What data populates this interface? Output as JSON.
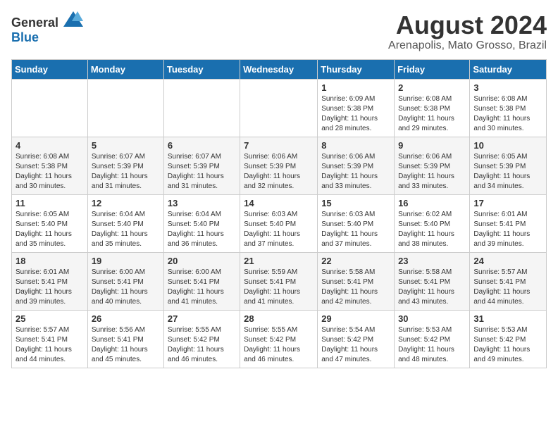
{
  "header": {
    "logo_general": "General",
    "logo_blue": "Blue",
    "title": "August 2024",
    "subtitle": "Arenapolis, Mato Grosso, Brazil"
  },
  "columns": [
    "Sunday",
    "Monday",
    "Tuesday",
    "Wednesday",
    "Thursday",
    "Friday",
    "Saturday"
  ],
  "rows": [
    [
      {
        "day": "",
        "info": ""
      },
      {
        "day": "",
        "info": ""
      },
      {
        "day": "",
        "info": ""
      },
      {
        "day": "",
        "info": ""
      },
      {
        "day": "1",
        "info": "Sunrise: 6:09 AM\nSunset: 5:38 PM\nDaylight: 11 hours and 28 minutes."
      },
      {
        "day": "2",
        "info": "Sunrise: 6:08 AM\nSunset: 5:38 PM\nDaylight: 11 hours and 29 minutes."
      },
      {
        "day": "3",
        "info": "Sunrise: 6:08 AM\nSunset: 5:38 PM\nDaylight: 11 hours and 30 minutes."
      }
    ],
    [
      {
        "day": "4",
        "info": "Sunrise: 6:08 AM\nSunset: 5:38 PM\nDaylight: 11 hours and 30 minutes."
      },
      {
        "day": "5",
        "info": "Sunrise: 6:07 AM\nSunset: 5:39 PM\nDaylight: 11 hours and 31 minutes."
      },
      {
        "day": "6",
        "info": "Sunrise: 6:07 AM\nSunset: 5:39 PM\nDaylight: 11 hours and 31 minutes."
      },
      {
        "day": "7",
        "info": "Sunrise: 6:06 AM\nSunset: 5:39 PM\nDaylight: 11 hours and 32 minutes."
      },
      {
        "day": "8",
        "info": "Sunrise: 6:06 AM\nSunset: 5:39 PM\nDaylight: 11 hours and 33 minutes."
      },
      {
        "day": "9",
        "info": "Sunrise: 6:06 AM\nSunset: 5:39 PM\nDaylight: 11 hours and 33 minutes."
      },
      {
        "day": "10",
        "info": "Sunrise: 6:05 AM\nSunset: 5:39 PM\nDaylight: 11 hours and 34 minutes."
      }
    ],
    [
      {
        "day": "11",
        "info": "Sunrise: 6:05 AM\nSunset: 5:40 PM\nDaylight: 11 hours and 35 minutes."
      },
      {
        "day": "12",
        "info": "Sunrise: 6:04 AM\nSunset: 5:40 PM\nDaylight: 11 hours and 35 minutes."
      },
      {
        "day": "13",
        "info": "Sunrise: 6:04 AM\nSunset: 5:40 PM\nDaylight: 11 hours and 36 minutes."
      },
      {
        "day": "14",
        "info": "Sunrise: 6:03 AM\nSunset: 5:40 PM\nDaylight: 11 hours and 37 minutes."
      },
      {
        "day": "15",
        "info": "Sunrise: 6:03 AM\nSunset: 5:40 PM\nDaylight: 11 hours and 37 minutes."
      },
      {
        "day": "16",
        "info": "Sunrise: 6:02 AM\nSunset: 5:40 PM\nDaylight: 11 hours and 38 minutes."
      },
      {
        "day": "17",
        "info": "Sunrise: 6:01 AM\nSunset: 5:41 PM\nDaylight: 11 hours and 39 minutes."
      }
    ],
    [
      {
        "day": "18",
        "info": "Sunrise: 6:01 AM\nSunset: 5:41 PM\nDaylight: 11 hours and 39 minutes."
      },
      {
        "day": "19",
        "info": "Sunrise: 6:00 AM\nSunset: 5:41 PM\nDaylight: 11 hours and 40 minutes."
      },
      {
        "day": "20",
        "info": "Sunrise: 6:00 AM\nSunset: 5:41 PM\nDaylight: 11 hours and 41 minutes."
      },
      {
        "day": "21",
        "info": "Sunrise: 5:59 AM\nSunset: 5:41 PM\nDaylight: 11 hours and 41 minutes."
      },
      {
        "day": "22",
        "info": "Sunrise: 5:58 AM\nSunset: 5:41 PM\nDaylight: 11 hours and 42 minutes."
      },
      {
        "day": "23",
        "info": "Sunrise: 5:58 AM\nSunset: 5:41 PM\nDaylight: 11 hours and 43 minutes."
      },
      {
        "day": "24",
        "info": "Sunrise: 5:57 AM\nSunset: 5:41 PM\nDaylight: 11 hours and 44 minutes."
      }
    ],
    [
      {
        "day": "25",
        "info": "Sunrise: 5:57 AM\nSunset: 5:41 PM\nDaylight: 11 hours and 44 minutes."
      },
      {
        "day": "26",
        "info": "Sunrise: 5:56 AM\nSunset: 5:41 PM\nDaylight: 11 hours and 45 minutes."
      },
      {
        "day": "27",
        "info": "Sunrise: 5:55 AM\nSunset: 5:42 PM\nDaylight: 11 hours and 46 minutes."
      },
      {
        "day": "28",
        "info": "Sunrise: 5:55 AM\nSunset: 5:42 PM\nDaylight: 11 hours and 46 minutes."
      },
      {
        "day": "29",
        "info": "Sunrise: 5:54 AM\nSunset: 5:42 PM\nDaylight: 11 hours and 47 minutes."
      },
      {
        "day": "30",
        "info": "Sunrise: 5:53 AM\nSunset: 5:42 PM\nDaylight: 11 hours and 48 minutes."
      },
      {
        "day": "31",
        "info": "Sunrise: 5:53 AM\nSunset: 5:42 PM\nDaylight: 11 hours and 49 minutes."
      }
    ]
  ]
}
